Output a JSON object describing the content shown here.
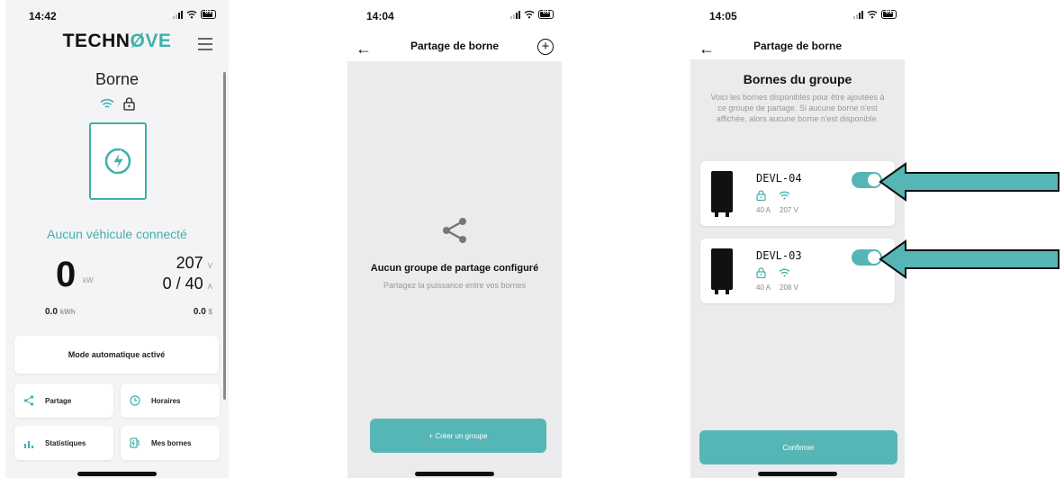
{
  "screen1": {
    "time": "14:42",
    "battery": "81",
    "brand_prefix": "TECHN",
    "brand_o": "Ø",
    "brand_suffix": "VE",
    "title": "Borne",
    "status": "Aucun véhicule connecté",
    "power_value": "0",
    "power_unit": "kW",
    "voltage_value": "207",
    "voltage_unit": "V",
    "current_value": "0 / 40",
    "current_unit": "A",
    "energy_value": "0.0",
    "energy_unit": "kWh",
    "cost_value": "0.0",
    "cost_unit": "$",
    "mode_label": "Mode automatique activé",
    "tiles": {
      "partage": "Partage",
      "horaires": "Horaires",
      "statistiques": "Statistiques",
      "mes_bornes": "Mes bornes"
    },
    "accent_color": "#3fb0ac"
  },
  "screen2": {
    "time": "14:04",
    "battery": "81",
    "title": "Partage de borne",
    "empty_title": "Aucun groupe de partage configuré",
    "empty_subtitle": "Partagez la puissance entre vos bornes",
    "create_button": "+ Créer un groupe"
  },
  "screen3": {
    "time": "14:05",
    "battery": "81",
    "title": "Partage de borne",
    "group_title": "Bornes du groupe",
    "group_description": "Voici les bornes disponibles pour être ajoutées à ce groupe de partage. Si aucune borne n'est affichée, alors aucune borne n'est disponible.",
    "bornes": [
      {
        "name": "DEVL-04",
        "current": "40 A",
        "voltage": "207 V",
        "enabled": true
      },
      {
        "name": "DEVL-03",
        "current": "40 A",
        "voltage": "208 V",
        "enabled": true
      }
    ],
    "confirm_button": "Confirmer",
    "button_color": "#56b6b5"
  },
  "annotation_arrow_color": "#56b6b5"
}
